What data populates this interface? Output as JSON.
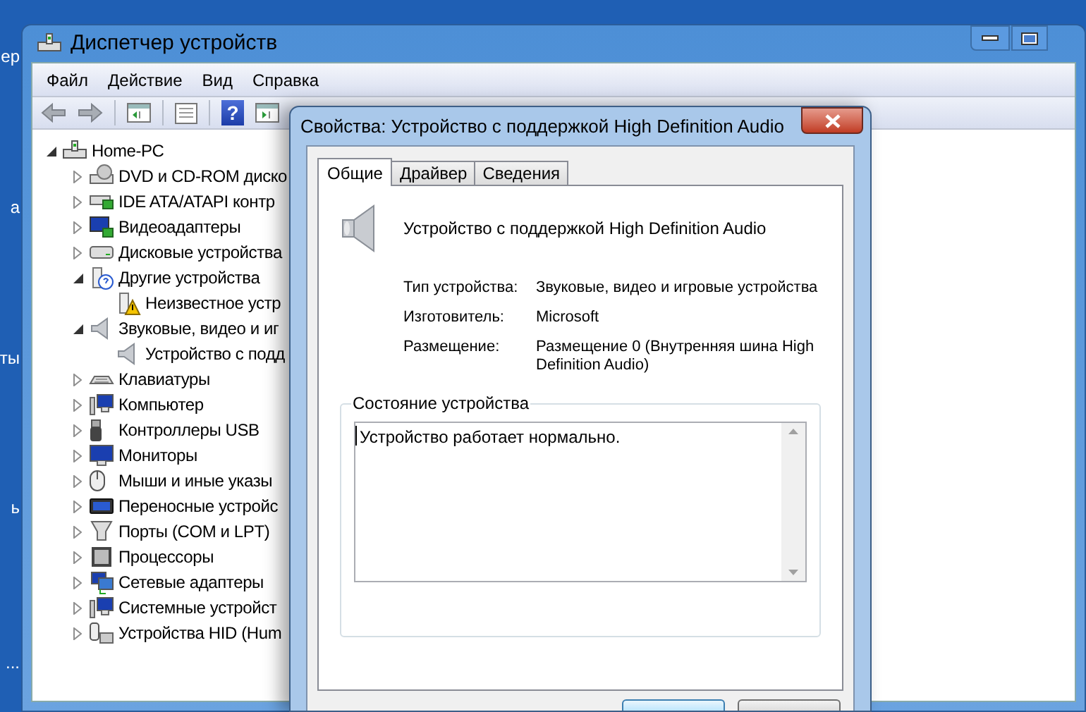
{
  "desktop_labels": [
    "ер",
    "а",
    "ты",
    "ь",
    "..."
  ],
  "main_window": {
    "title": "Диспетчер устройств",
    "menu": [
      "Файл",
      "Действие",
      "Вид",
      "Справка"
    ],
    "toolbar": [
      {
        "kind": "back"
      },
      {
        "kind": "forward"
      },
      {
        "kind": "sep"
      },
      {
        "kind": "tree"
      },
      {
        "kind": "sep"
      },
      {
        "kind": "sheet"
      },
      {
        "kind": "sep"
      },
      {
        "kind": "help",
        "label": "?"
      },
      {
        "kind": "action"
      }
    ],
    "tree": [
      {
        "label": "Home-PC",
        "kind": "computer",
        "expanded": true,
        "children": [
          {
            "label": "DVD и CD-ROM диско",
            "kind": "drive",
            "expanded": false
          },
          {
            "label": "IDE ATA/ATAPI контр",
            "kind": "controller",
            "expanded": false
          },
          {
            "label": "Видеоадаптеры",
            "kind": "display",
            "expanded": false
          },
          {
            "label": "Дисковые устройства",
            "kind": "disk",
            "expanded": false
          },
          {
            "label": "Другие устройства",
            "kind": "unknown",
            "expanded": true,
            "children": [
              {
                "label": "Неизвестное устр",
                "kind": "warning"
              }
            ]
          },
          {
            "label": "Звуковые, видео и иг",
            "kind": "speaker",
            "expanded": true,
            "children": [
              {
                "label": "Устройство с подд",
                "kind": "speaker"
              }
            ]
          },
          {
            "label": "Клавиатуры",
            "kind": "keyboard",
            "expanded": false
          },
          {
            "label": "Компьютер",
            "kind": "system",
            "expanded": false
          },
          {
            "label": "Контроллеры USB",
            "kind": "usb",
            "expanded": false
          },
          {
            "label": "Мониторы",
            "kind": "monitor",
            "expanded": false
          },
          {
            "label": "Мыши и иные указы",
            "kind": "mouse",
            "expanded": false
          },
          {
            "label": "Переносные устройс",
            "kind": "portable",
            "expanded": false
          },
          {
            "label": "Порты (COM и LPT)",
            "kind": "port",
            "expanded": false
          },
          {
            "label": "Процессоры",
            "kind": "cpu",
            "expanded": false
          },
          {
            "label": "Сетевые адаптеры",
            "kind": "network",
            "expanded": false
          },
          {
            "label": "Системные устройст",
            "kind": "system",
            "expanded": false
          },
          {
            "label": "Устройства HID (Hum",
            "kind": "hid",
            "expanded": false
          }
        ]
      }
    ]
  },
  "dialog": {
    "title": "Свойства: Устройство с поддержкой High Definition Audio",
    "tabs": [
      {
        "label": "Общие",
        "selected": true
      },
      {
        "label": "Драйвер",
        "selected": false
      },
      {
        "label": "Сведения",
        "selected": false
      }
    ],
    "device_name": "Устройство с поддержкой High Definition Audio",
    "properties": [
      {
        "label": "Тип устройства:",
        "value": "Звуковые, видео и игровые устройства"
      },
      {
        "label": "Изготовитель:",
        "value": "Microsoft"
      },
      {
        "label": "Размещение:",
        "value": "Размещение 0 (Внутренняя шина High Definition Audio)"
      }
    ],
    "status_group": {
      "title": "Состояние устройства",
      "text": "Устройство работает нормально."
    },
    "buttons": [
      {
        "focused": true
      },
      {
        "focused": false
      }
    ]
  }
}
